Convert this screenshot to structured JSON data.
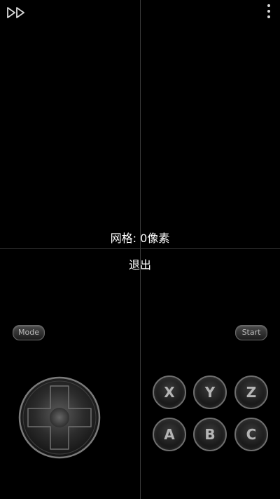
{
  "overlay": {
    "grid_label": "网格: 0像素",
    "exit_label": "退出"
  },
  "toolbar": {
    "fast_forward_icon": "fast-forward-icon",
    "menu_icon": "more-vertical-icon"
  },
  "gamepad": {
    "mode_label": "Mode",
    "start_label": "Start",
    "buttons": [
      "X",
      "Y",
      "Z",
      "A",
      "B",
      "C"
    ],
    "dpad_icon": "dpad-icon"
  }
}
